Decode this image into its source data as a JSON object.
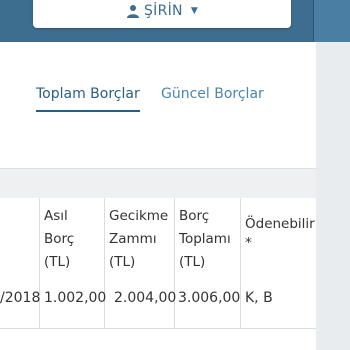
{
  "header": {
    "user_name": "ŞİRİN",
    "user_icon": "person-icon",
    "caret_icon": "caret-down-icon"
  },
  "tabs": [
    {
      "label": "Toplam Borçlar",
      "active": true
    },
    {
      "label": "Güncel Borçlar",
      "active": false
    }
  ],
  "table": {
    "columns": [
      {
        "line1": "Asıl",
        "line2": "Borç",
        "line3": "(TL)"
      },
      {
        "line1": "Gecikme",
        "line2": "Zammı",
        "line3": "(TL)"
      },
      {
        "line1": "Borç",
        "line2": "Toplamı",
        "line3": "(TL)"
      },
      {
        "line1": "Ödenebilir",
        "line2": "*",
        "line3": ""
      }
    ],
    "rows": [
      {
        "date": "/2018",
        "principal": "1.002,00",
        "late_fee": "2.004,00",
        "total": "3.006,00",
        "payable": "K, B"
      }
    ]
  },
  "colors": {
    "header_bg": "#3d6d8f",
    "tab_active": "#2a5f85",
    "tab_inactive": "#4a86b3"
  }
}
